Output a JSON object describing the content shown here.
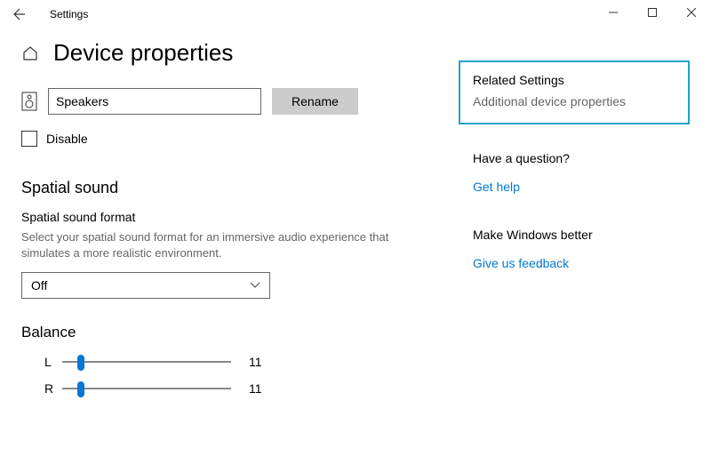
{
  "titlebar": {
    "title": "Settings"
  },
  "header": {
    "page_title": "Device properties"
  },
  "device": {
    "name_value": "Speakers",
    "rename_label": "Rename"
  },
  "disable": {
    "label": "Disable",
    "checked": false
  },
  "spatial": {
    "section_title": "Spatial sound",
    "field_label": "Spatial sound format",
    "description": "Select your spatial sound format for an immersive audio experience that simulates a more realistic environment.",
    "selected": "Off"
  },
  "balance": {
    "title": "Balance",
    "left_label": "L",
    "left_value": "11",
    "right_label": "R",
    "right_value": "11"
  },
  "side": {
    "related_heading": "Related Settings",
    "additional_link": "Additional device properties",
    "question_heading": "Have a question?",
    "get_help_link": "Get help",
    "feedback_heading": "Make Windows better",
    "feedback_link": "Give us feedback"
  }
}
